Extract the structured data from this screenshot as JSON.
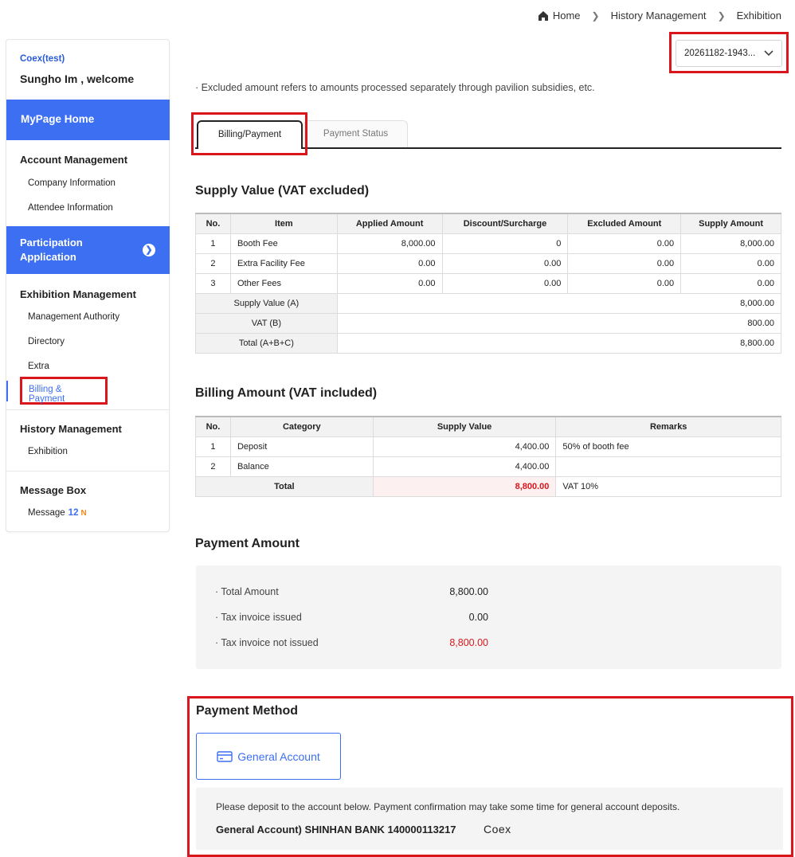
{
  "breadcrumb": {
    "home": "Home",
    "level1": "History Management",
    "level2": "Exhibition"
  },
  "event_select": {
    "value": "20261182-1943..."
  },
  "sidebar": {
    "company": "Coex(test)",
    "welcome": "Sungho Im , welcome",
    "home": "MyPage Home",
    "account_section": "Account Management",
    "account_items": [
      "Company Information",
      "Attendee Information"
    ],
    "participation": "Participation Application",
    "exhibition_section": "Exhibition Management",
    "exhibition_items": [
      "Management Authority",
      "Directory",
      "Extra",
      "Billing & Payment"
    ],
    "history_section": "History Management",
    "history_items": [
      "Exhibition"
    ],
    "message_section": "Message Box",
    "message_label": "Message",
    "message_count": "12",
    "message_new": "N"
  },
  "notice": "· Excluded amount refers to amounts processed separately through pavilion subsidies, etc.",
  "tabs": {
    "active": "Billing/Payment",
    "inactive": "Payment Status"
  },
  "supply": {
    "title": "Supply Value (VAT excluded)",
    "headers": [
      "No.",
      "Item",
      "Applied Amount",
      "Discount/Surcharge",
      "Excluded Amount",
      "Supply Amount"
    ],
    "rows": [
      [
        "1",
        "Booth Fee",
        "8,000.00",
        "0",
        "0.00",
        "8,000.00"
      ],
      [
        "2",
        "Extra Facility Fee",
        "0.00",
        "0.00",
        "0.00",
        "0.00"
      ],
      [
        "3",
        "Other Fees",
        "0.00",
        "0.00",
        "0.00",
        "0.00"
      ]
    ],
    "summary": [
      {
        "label": "Supply Value (A)",
        "value": "8,000.00"
      },
      {
        "label": "VAT (B)",
        "value": "800.00"
      },
      {
        "label": "Total (A+B+C)",
        "value": "8,800.00"
      }
    ]
  },
  "billing": {
    "title": "Billing Amount (VAT included)",
    "headers": [
      "No.",
      "Category",
      "Supply Value",
      "Remarks"
    ],
    "rows": [
      [
        "1",
        "Deposit",
        "4,400.00",
        "50% of booth fee"
      ],
      [
        "2",
        "Balance",
        "4,400.00",
        ""
      ]
    ],
    "total_label": "Total",
    "total_value": "8,800.00",
    "total_remark": "VAT 10%"
  },
  "payment": {
    "title": "Payment Amount",
    "rows": [
      {
        "label": "· Total Amount",
        "value": "8,800.00"
      },
      {
        "label": "· Tax invoice issued",
        "value": "0.00"
      },
      {
        "label": "· Tax invoice not issued",
        "value": "8,800.00"
      }
    ]
  },
  "method": {
    "title": "Payment Method",
    "button": "General Account",
    "note": "Please deposit to the account below. Payment confirmation may take some time for general account deposits.",
    "account": "General Account) SHINHAN BANK 140000113217",
    "holder": "Coex"
  },
  "colors": {
    "accent": "#3d6ff2",
    "highlight": "#d9161c",
    "new_badge": "#f08a24"
  }
}
